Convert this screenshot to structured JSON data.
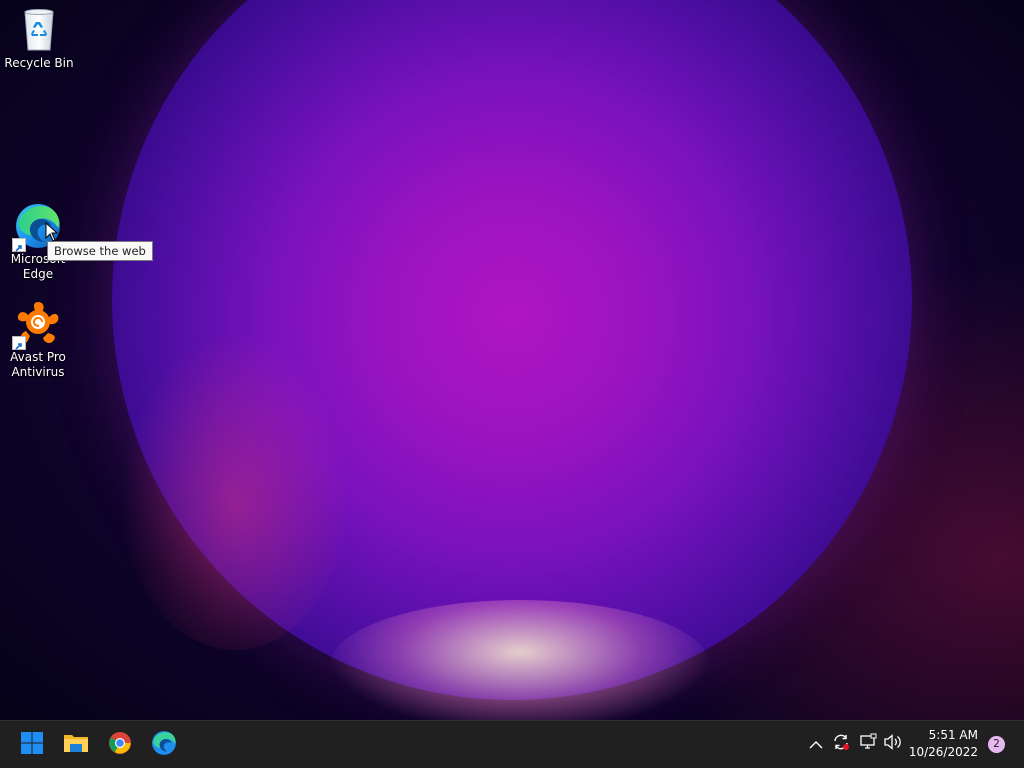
{
  "desktop": {
    "icons": [
      {
        "name": "recycle-bin",
        "label": "Recycle Bin"
      },
      {
        "name": "microsoft-edge",
        "label": "Microsoft Edge"
      },
      {
        "name": "avast-pro-antivirus",
        "label": "Avast Pro Antivirus"
      }
    ],
    "tooltip": "Browse the web"
  },
  "taskbar": {
    "pinned": [
      {
        "name": "start-button",
        "icon": "windows-logo-icon"
      },
      {
        "name": "file-explorer-button",
        "icon": "folder-icon"
      },
      {
        "name": "chrome-button",
        "icon": "chrome-icon"
      },
      {
        "name": "edge-button",
        "icon": "edge-icon"
      }
    ],
    "tray": {
      "icons": [
        "chevron-up-icon",
        "sync-icon",
        "network-icon",
        "volume-icon"
      ],
      "time": "5:51 AM",
      "date": "10/26/2022",
      "notification_count": "2"
    }
  },
  "colors": {
    "taskbar_bg": "#202020",
    "windows_blue": "#1e8ef5",
    "accent_badge": "#e7b7f2"
  }
}
